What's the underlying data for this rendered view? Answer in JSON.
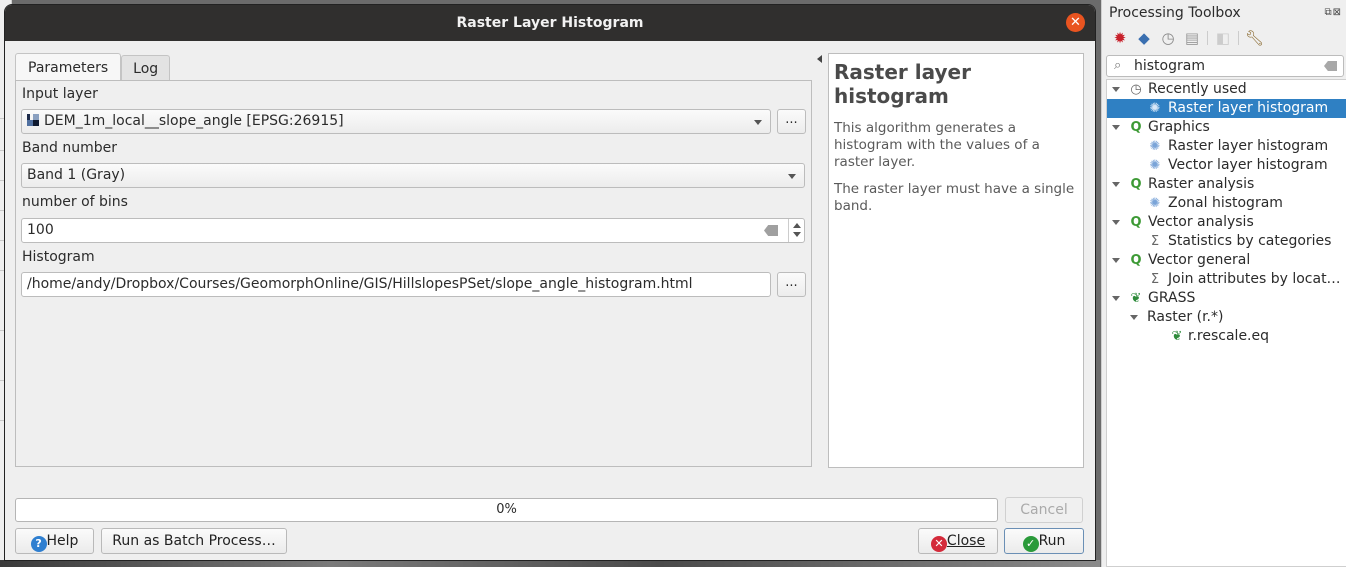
{
  "dialog": {
    "title": "Raster Layer Histogram",
    "tabs": [
      {
        "label": "Parameters",
        "active": true
      },
      {
        "label": "Log",
        "active": false
      }
    ],
    "params": {
      "input_layer_label": "Input layer",
      "input_layer_value": "DEM_1m_local__slope_angle [EPSG:26915]",
      "band_label": "Band number",
      "band_value": "Band 1 (Gray)",
      "bins_label": "number of bins",
      "bins_value": "100",
      "histogram_label": "Histogram",
      "histogram_value": "/home/andy/Dropbox/Courses/GeomorphOnline/GIS/HillslopesPSet/slope_angle_histogram.html",
      "browse_label": "..."
    },
    "help": {
      "title": "Raster layer histogram",
      "paragraphs": [
        "This algorithm generates a histogram with the values of a raster layer.",
        "The raster layer must have a single band."
      ]
    },
    "progress": {
      "percent": 0,
      "label": "0%"
    },
    "buttons": {
      "cancel": "Cancel",
      "help": "Help",
      "batch": "Run as Batch Process…",
      "close": "Close",
      "run": "Run"
    }
  },
  "toolbox": {
    "title": "Processing Toolbox",
    "search_value": "histogram",
    "tree": [
      {
        "label": "Recently used",
        "level": 0,
        "icon": "clock-icon",
        "expanded": true
      },
      {
        "label": "Raster layer histogram",
        "level": 1,
        "icon": "gear-icon",
        "selected": true
      },
      {
        "label": "Graphics",
        "level": 0,
        "icon": "qgis-icon",
        "expanded": true
      },
      {
        "label": "Raster layer histogram",
        "level": 1,
        "icon": "gear-icon"
      },
      {
        "label": "Vector layer histogram",
        "level": 1,
        "icon": "gear-icon"
      },
      {
        "label": "Raster analysis",
        "level": 0,
        "icon": "qgis-icon",
        "expanded": true
      },
      {
        "label": "Zonal histogram",
        "level": 1,
        "icon": "gear-icon"
      },
      {
        "label": "Vector analysis",
        "level": 0,
        "icon": "qgis-icon",
        "expanded": true
      },
      {
        "label": "Statistics by categories",
        "level": 1,
        "icon": "sigma-icon"
      },
      {
        "label": "Vector general",
        "level": 0,
        "icon": "qgis-icon",
        "expanded": true
      },
      {
        "label": "Join attributes by locat…",
        "level": 1,
        "icon": "sigma-icon"
      },
      {
        "label": "GRASS",
        "level": 0,
        "icon": "grass-icon",
        "expanded": true
      },
      {
        "label": "Raster (r.*)",
        "level": 1,
        "icon": "",
        "expanded": true
      },
      {
        "label": "r.rescale.eq",
        "level": 2,
        "icon": "grass-icon"
      }
    ]
  }
}
